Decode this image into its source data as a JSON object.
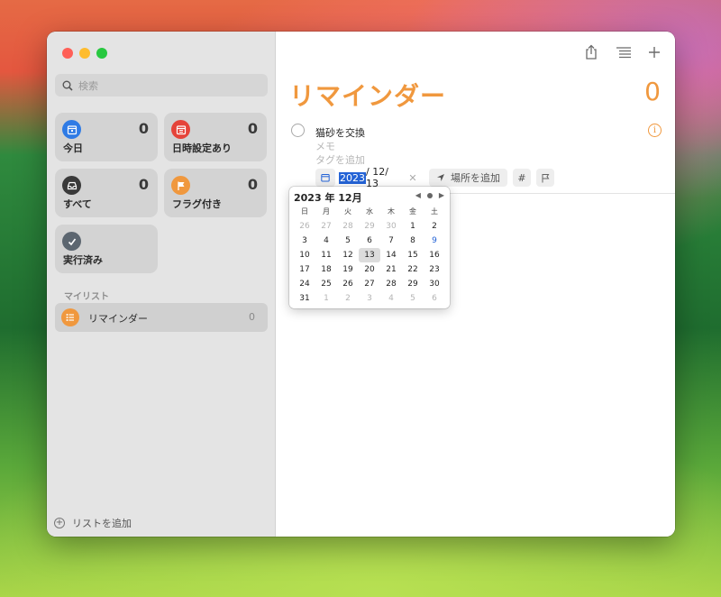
{
  "sidebar": {
    "search_placeholder": "検索",
    "smart_lists": [
      {
        "label": "今日",
        "count": "0",
        "color": "#2f7be5",
        "icon": "calendar-today-icon"
      },
      {
        "label": "日時設定あり",
        "count": "0",
        "color": "#e5443a",
        "icon": "calendar-grid-icon"
      },
      {
        "label": "すべて",
        "count": "0",
        "color": "#3a3a3a",
        "icon": "tray-icon"
      },
      {
        "label": "フラグ付き",
        "count": "0",
        "color": "#f0983e",
        "icon": "flag-icon"
      },
      {
        "label": "実行済み",
        "count": "",
        "color": "#5c6670",
        "icon": "checkmark-icon"
      }
    ],
    "section_title": "マイリスト",
    "lists": [
      {
        "label": "リマインダー",
        "count": "0",
        "color": "#f0983e",
        "icon": "list-bullet-icon"
      }
    ],
    "add_list_label": "リストを追加"
  },
  "main": {
    "title": "リマインダー",
    "count": "0",
    "accent_color": "#f0983e",
    "task": {
      "title": "猫砂を交換",
      "memo_placeholder": "メモ",
      "tag_placeholder": "タグを追加",
      "date_year": "2023",
      "date_rest": "/ 12/ 13",
      "location_label": "場所を追加",
      "tag_button": "#"
    }
  },
  "calendar": {
    "month_label": "2023 年 12月",
    "weekdays": [
      "日",
      "月",
      "火",
      "水",
      "木",
      "金",
      "土"
    ],
    "weeks": [
      [
        "26",
        "27",
        "28",
        "29",
        "30",
        "1",
        "2"
      ],
      [
        "3",
        "4",
        "5",
        "6",
        "7",
        "8",
        "9"
      ],
      [
        "10",
        "11",
        "12",
        "13",
        "14",
        "15",
        "16"
      ],
      [
        "17",
        "18",
        "19",
        "20",
        "21",
        "22",
        "23"
      ],
      [
        "24",
        "25",
        "26",
        "27",
        "28",
        "29",
        "30"
      ],
      [
        "31",
        "1",
        "2",
        "3",
        "4",
        "5",
        "6"
      ]
    ],
    "selected_day": "13",
    "highlight_color": "#2463d6"
  }
}
